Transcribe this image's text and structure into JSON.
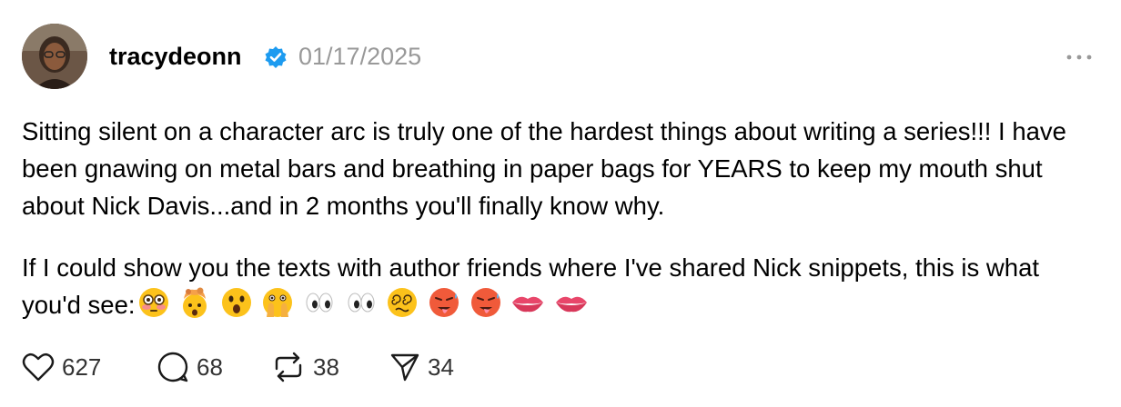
{
  "post": {
    "username": "tracydeonn",
    "verified": true,
    "timestamp": "01/17/2025",
    "paragraph1": "Sitting silent on a character arc is truly one of the hardest things about writing a series!!! I have been gnawing on metal bars and breathing in paper bags for YEARS to keep my mouth shut about Nick Davis...and in 2 months you'll finally know why.",
    "paragraph2": "If I could show you the texts with author friends where I've shared Nick snippets, this is what you'd see:",
    "emojis": [
      "flushed-face",
      "exploding-head",
      "astonished-face",
      "face-with-open-eyes-and-hand-over-mouth",
      "eyes",
      "eyes",
      "face-with-spiral-eyes",
      "hot-face",
      "hot-face",
      "lips",
      "lips"
    ]
  },
  "actions": {
    "like": {
      "icon": "heart-icon",
      "count": "627"
    },
    "reply": {
      "icon": "comment-icon",
      "count": "68"
    },
    "repost": {
      "icon": "repost-icon",
      "count": "38"
    },
    "share": {
      "icon": "send-icon",
      "count": "34"
    }
  },
  "colors": {
    "verified_blue": "#1d9bf0",
    "timestamp_gray": "#999999",
    "icon_dark": "#1a1a1a"
  }
}
